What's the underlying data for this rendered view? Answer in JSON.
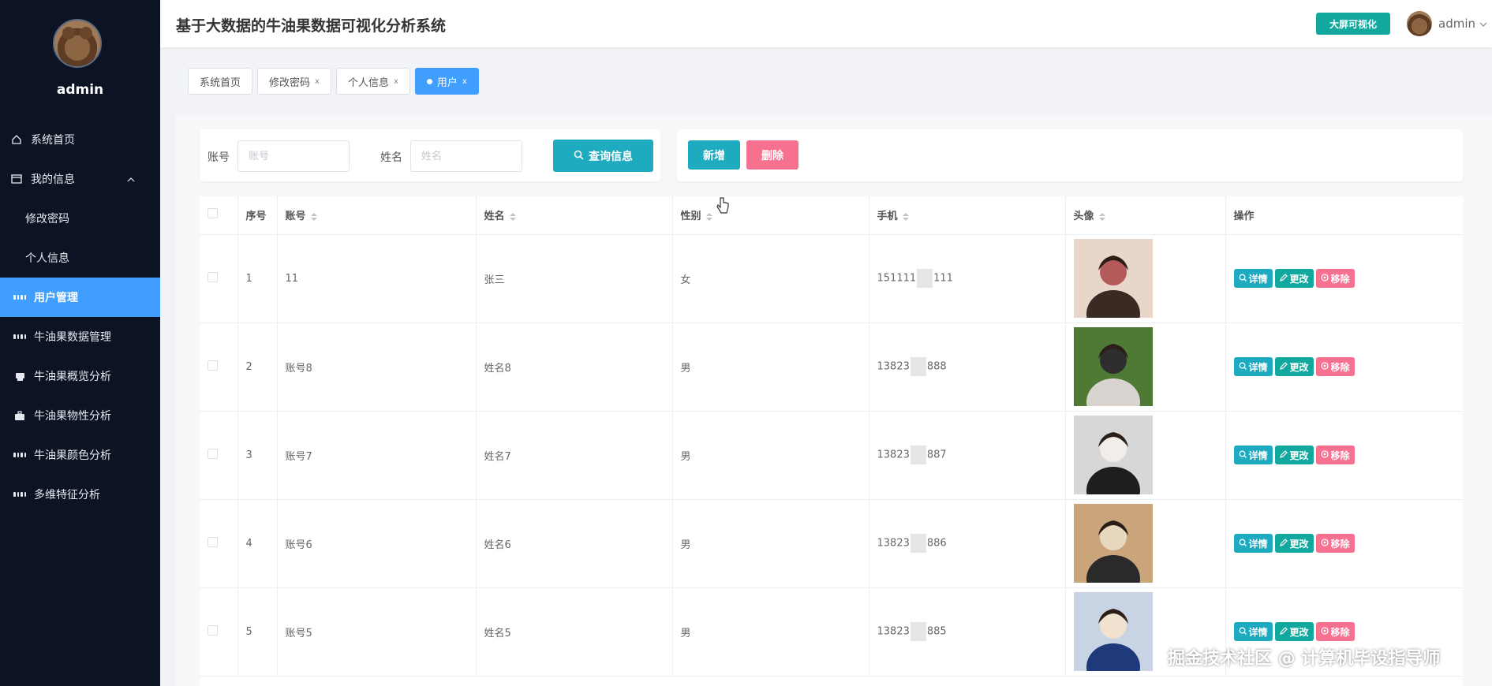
{
  "header": {
    "title": "基于大数据的牛油果数据可视化分析系统",
    "bigscreen_label": "大屏可视化",
    "user": "admin"
  },
  "sidebar": {
    "user": "admin",
    "items": [
      {
        "label": "系统首页",
        "icon": "home-icon"
      },
      {
        "label": "我的信息",
        "icon": "card-icon"
      },
      {
        "label": "修改密码"
      },
      {
        "label": "个人信息"
      },
      {
        "label": "用户管理",
        "icon": "grid-icon"
      },
      {
        "label": "牛油果数据管理",
        "icon": "grid-icon"
      },
      {
        "label": "牛油果概览分析",
        "icon": "printer-icon"
      },
      {
        "label": "牛油果物性分析",
        "icon": "briefcase-icon"
      },
      {
        "label": "牛油果颜色分析",
        "icon": "grid-icon"
      },
      {
        "label": "多维特征分析",
        "icon": "grid-icon"
      }
    ]
  },
  "tabs": [
    {
      "label": "系统首页"
    },
    {
      "label": "修改密码",
      "close": "x"
    },
    {
      "label": "个人信息",
      "close": "x"
    },
    {
      "label": "用户",
      "close": "x"
    }
  ],
  "search": {
    "account_label": "账号",
    "account_placeholder": "账号",
    "name_label": "姓名",
    "name_placeholder": "姓名",
    "query_label": "查询信息"
  },
  "actions": {
    "add_label": "新增",
    "delete_label": "删除"
  },
  "colors": {
    "accent": "#409eff",
    "teal": "#1eaabf",
    "green": "#13a89e",
    "pink": "#f5718f",
    "sidebar": "#0c1424"
  },
  "table": {
    "headers": {
      "index": "序号",
      "account": "账号",
      "name": "姓名",
      "gender": "性别",
      "phone": "手机",
      "avatar": "头像",
      "ops": "操作"
    },
    "op_labels": {
      "detail": "详情",
      "edit": "更改",
      "remove": "移除"
    },
    "rows": [
      {
        "index": "1",
        "account": "11",
        "name": "张三",
        "gender": "女",
        "phone_a": "151111",
        "phone_b": "111"
      },
      {
        "index": "2",
        "account": "账号8",
        "name": "姓名8",
        "gender": "男",
        "phone_a": "13823",
        "phone_b": "888"
      },
      {
        "index": "3",
        "account": "账号7",
        "name": "姓名7",
        "gender": "男",
        "phone_a": "13823",
        "phone_b": "887"
      },
      {
        "index": "4",
        "account": "账号6",
        "name": "姓名6",
        "gender": "男",
        "phone_a": "13823",
        "phone_b": "886"
      },
      {
        "index": "5",
        "account": "账号5",
        "name": "姓名5",
        "gender": "男",
        "phone_a": "13823",
        "phone_b": "885"
      }
    ]
  },
  "watermark": "掘金技术社区 @ 计算机毕设指导师"
}
